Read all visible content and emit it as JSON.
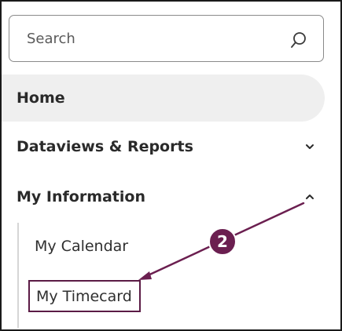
{
  "search": {
    "placeholder": "Search"
  },
  "nav": {
    "items": [
      {
        "label": "Home",
        "expanded": null
      },
      {
        "label": "Dataviews & Reports",
        "expanded": false
      },
      {
        "label": "My Information",
        "expanded": true
      }
    ],
    "sub_items": [
      {
        "label": "My Calendar"
      },
      {
        "label": "My Timecard"
      }
    ]
  },
  "annotation": {
    "step_number": "2",
    "color": "#6b1f50"
  },
  "colors": {
    "highlight_bg": "#efefef",
    "text": "#2a2a2a",
    "border": "#8a8a8a",
    "annotation": "#6b1f50"
  },
  "icons": {
    "search": "search-icon",
    "dataviews_chevron": "chevron-down-icon",
    "myinfo_chevron": "chevron-up-icon"
  }
}
